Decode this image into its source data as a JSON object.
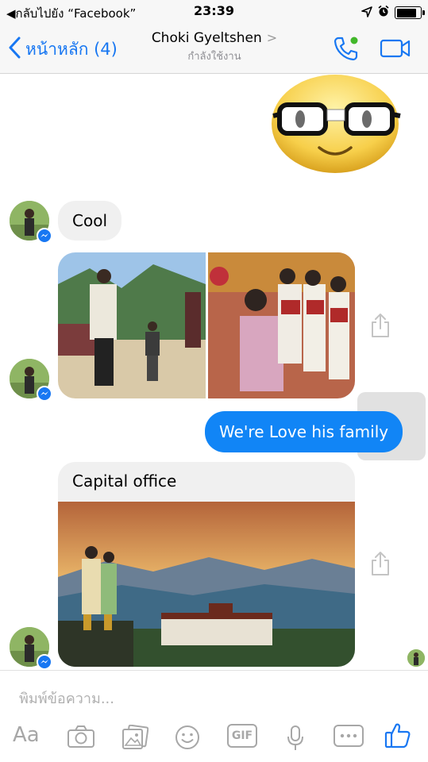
{
  "status_bar": {
    "back_app": "◀กลับไปยัง “Facebook”",
    "time": "23:39",
    "battery_percent": 85
  },
  "nav": {
    "back_label": "หน้าหลัก (4)",
    "contact_name": "Choki Gyeltshen",
    "status": "กำลังใช้งาน"
  },
  "messages": {
    "cool": "Cool",
    "outgoing": "We're Love his family",
    "card_title": "Capital office"
  },
  "composer": {
    "placeholder": "พิมพ์ข้อความ...",
    "aa_label": "Aa",
    "gif_label": "GIF"
  },
  "colors": {
    "accent": "#1877f2",
    "outgoing_bubble": "#1185f6",
    "incoming_bubble": "#f0f0f0",
    "online_dot": "#42b72a"
  }
}
